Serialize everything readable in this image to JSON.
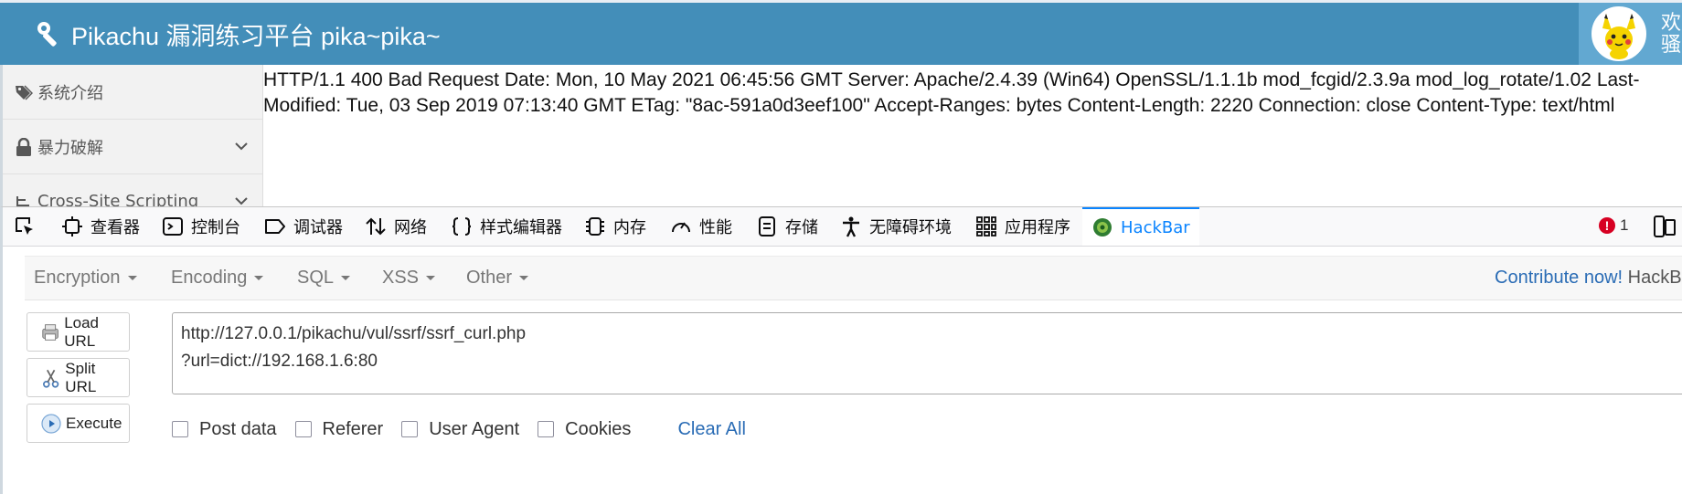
{
  "header": {
    "title": "Pikachu 漏洞练习平台 pika~pika~",
    "welcome_line1": "欢迎",
    "welcome_line2": "骚年"
  },
  "sidebar": {
    "items": [
      {
        "label": "系统介绍",
        "icon": "tag-icon",
        "expandable": false
      },
      {
        "label": "暴力破解",
        "icon": "lock-icon",
        "expandable": true
      },
      {
        "label": "Cross-Site Scripting",
        "icon": "sitemap-icon",
        "expandable": true
      }
    ]
  },
  "response": {
    "text": "HTTP/1.1 400 Bad Request Date: Mon, 10 May 2021 06:45:56 GMT Server: Apache/2.4.39 (Win64) OpenSSL/1.1.1b mod_fcgid/2.3.9a mod_log_rotate/1.02 Last-Modified: Tue, 03 Sep 2019 07:13:40 GMT ETag: \"8ac-591a0d3eef100\" Accept-Ranges: bytes Content-Length: 2220 Connection: close Content-Type: text/html"
  },
  "devtools": {
    "tabs": [
      {
        "label": "查看器",
        "icon": "inspector-icon"
      },
      {
        "label": "控制台",
        "icon": "console-icon"
      },
      {
        "label": "调试器",
        "icon": "debugger-icon"
      },
      {
        "label": "网络",
        "icon": "network-icon"
      },
      {
        "label": "样式编辑器",
        "icon": "style-editor-icon"
      },
      {
        "label": "内存",
        "icon": "memory-icon"
      },
      {
        "label": "性能",
        "icon": "performance-icon"
      },
      {
        "label": "存储",
        "icon": "storage-icon"
      },
      {
        "label": "无障碍环境",
        "icon": "accessibility-icon"
      },
      {
        "label": "应用程序",
        "icon": "application-icon"
      },
      {
        "label": "HackBar",
        "icon": "hackbar-icon"
      }
    ],
    "active_tab": "HackBar",
    "error_count": "1",
    "accent": "#0a84ff"
  },
  "hackbar": {
    "menu": [
      "Encryption",
      "Encoding",
      "SQL",
      "XSS",
      "Other"
    ],
    "contribute_link": "Contribute now!",
    "contribute_rest": "HackBar",
    "buttons": {
      "load_url": "Load URL",
      "split_url": "Split URL",
      "execute": "Execute"
    },
    "url_line1": "http://127.0.0.1/pikachu/vul/ssrf/ssrf_curl.php",
    "url_line2": "?url=dict://192.168.1.6:80",
    "options": {
      "post_data": "Post data",
      "referer": "Referer",
      "user_agent": "User Agent",
      "cookies": "Cookies"
    },
    "clear_all": "Clear All"
  },
  "colors": {
    "header_bg": "#438eb9",
    "link": "#2a6cb5"
  }
}
